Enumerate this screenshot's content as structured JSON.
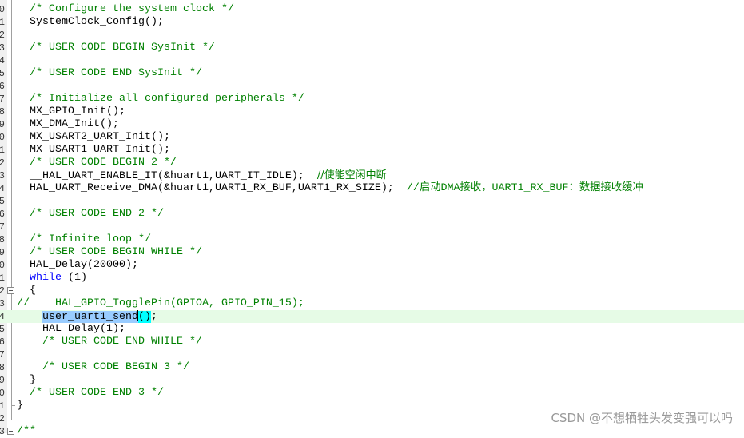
{
  "editor": {
    "line_number_fragments": [
      "0",
      "1",
      "2",
      "3",
      "4",
      "5",
      "6",
      "7",
      "8",
      "9",
      "0",
      "1",
      "2",
      "3",
      "4",
      "5",
      "6",
      "7",
      "8",
      "9",
      "0",
      "1",
      "2",
      "3",
      "4",
      "5",
      "6",
      "7",
      "8",
      "9",
      "0",
      "1",
      "2",
      "3"
    ],
    "current_line_index": 24,
    "fold_open_lines": [
      22,
      33
    ],
    "fold_end_lines": [
      29,
      31
    ],
    "lines": [
      [
        {
          "t": "  "
        },
        {
          "c": "comment",
          "t": "/* Configure the system clock */"
        }
      ],
      [
        {
          "t": "  SystemClock_Config();"
        }
      ],
      [],
      [
        {
          "t": "  "
        },
        {
          "c": "comment",
          "t": "/* USER CODE BEGIN SysInit */"
        }
      ],
      [],
      [
        {
          "t": "  "
        },
        {
          "c": "comment",
          "t": "/* USER CODE END SysInit */"
        }
      ],
      [],
      [
        {
          "t": "  "
        },
        {
          "c": "comment",
          "t": "/* Initialize all configured peripherals */"
        }
      ],
      [
        {
          "t": "  MX_GPIO_Init();"
        }
      ],
      [
        {
          "t": "  MX_DMA_Init();"
        }
      ],
      [
        {
          "t": "  MX_USART2_UART_Init();"
        }
      ],
      [
        {
          "t": "  MX_USART1_UART_Init();"
        }
      ],
      [
        {
          "t": "  "
        },
        {
          "c": "comment",
          "t": "/* USER CODE BEGIN 2 */"
        }
      ],
      [
        {
          "t": "  __HAL_UART_ENABLE_IT(&huart1,UART_IT_IDLE);  "
        },
        {
          "c": "cmt-cn",
          "t": "//使能空闲中断"
        }
      ],
      [
        {
          "t": "  HAL_UART_Receive_DMA(&huart1,UART1_RX_BUF,UART1_RX_SIZE);  "
        },
        {
          "c": "comment",
          "t": "//启动DMA接收，UART1_RX_BUF：数据接收缓冲"
        }
      ],
      [],
      [
        {
          "t": "  "
        },
        {
          "c": "comment",
          "t": "/* USER CODE END 2 */"
        }
      ],
      [],
      [
        {
          "t": "  "
        },
        {
          "c": "comment",
          "t": "/* Infinite loop */"
        }
      ],
      [
        {
          "t": "  "
        },
        {
          "c": "comment",
          "t": "/* USER CODE BEGIN WHILE */"
        }
      ],
      [
        {
          "t": "  HAL_Delay(20000);"
        }
      ],
      [
        {
          "t": "  "
        },
        {
          "c": "keyword",
          "t": "while"
        },
        {
          "t": " (1)"
        }
      ],
      [
        {
          "t": "  {"
        }
      ],
      [
        {
          "c": "comment",
          "t": "//    HAL_GPIO_TogglePin(GPIOA, GPIO_PIN_15);"
        }
      ],
      [
        {
          "t": "    "
        },
        {
          "c": "sel",
          "t": "user_uart1_send"
        },
        {
          "c": "caret",
          "t": ""
        },
        {
          "c": "brace",
          "t": "()"
        },
        {
          "t": ";"
        }
      ],
      [
        {
          "t": "    HAL_Delay(1);"
        }
      ],
      [
        {
          "t": "    "
        },
        {
          "c": "comment",
          "t": "/* USER CODE END WHILE */"
        }
      ],
      [],
      [
        {
          "t": "    "
        },
        {
          "c": "comment",
          "t": "/* USER CODE BEGIN 3 */"
        }
      ],
      [
        {
          "t": "  }"
        }
      ],
      [
        {
          "t": "  "
        },
        {
          "c": "comment",
          "t": "/* USER CODE END 3 */"
        }
      ],
      [
        {
          "t": "}"
        }
      ],
      [],
      [
        {
          "c": "comment",
          "t": "/**"
        }
      ]
    ]
  },
  "watermark": "CSDN @不想牺牲头发变强可以吗",
  "colors": {
    "comment": "#008000",
    "keyword": "#0000ff",
    "selection": "#99ccff",
    "brace_match": "#00ffff",
    "current_line": "#e6fbe6"
  }
}
